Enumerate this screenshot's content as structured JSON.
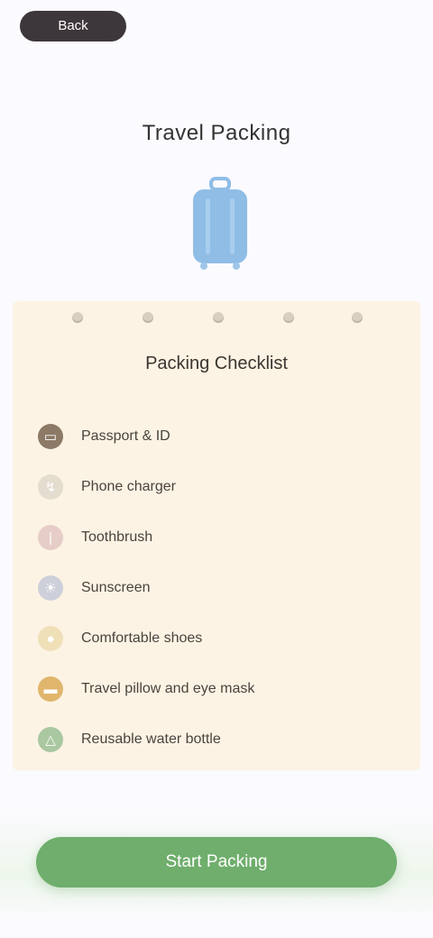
{
  "header": {
    "back_label": "Back",
    "app_title": "Travel Packing"
  },
  "hero": {
    "icon": "suitcase-icon",
    "color": "#8fbde6"
  },
  "card": {
    "title": "Packing Checklist",
    "background": "#fcf3e4",
    "items": [
      {
        "label": "Passport & ID",
        "icon": "passport-icon",
        "color": "#8c7a66"
      },
      {
        "label": "Phone charger",
        "icon": "charger-icon",
        "color": "#e4dccf"
      },
      {
        "label": "Toothbrush",
        "icon": "toothbrush-icon",
        "color": "#e6cdc8"
      },
      {
        "label": "Sunscreen",
        "icon": "sunscreen-icon",
        "color": "#cdd0da"
      },
      {
        "label": "Comfortable shoes",
        "icon": "shoe-icon",
        "color": "#efe0b8"
      },
      {
        "label": "Travel pillow and eye mask",
        "icon": "pillow-icon",
        "color": "#e0b66c"
      },
      {
        "label": "Reusable water bottle",
        "icon": "bottle-icon",
        "color": "#a9c7a0"
      }
    ]
  },
  "cta": {
    "label": "Start Packing",
    "color": "#6fae6c"
  }
}
